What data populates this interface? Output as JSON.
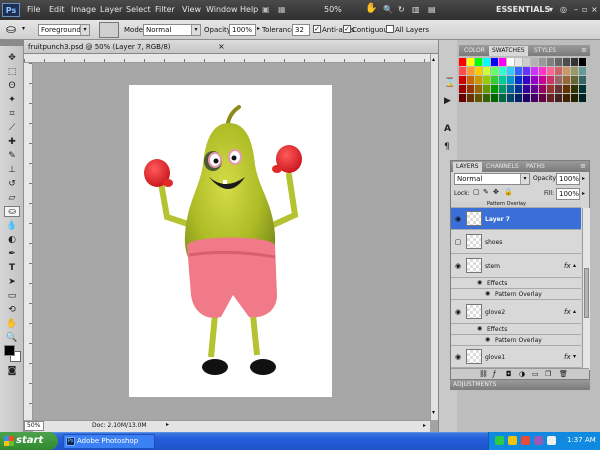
{
  "menubar": {
    "logo": "Ps",
    "items": [
      "File",
      "Edit",
      "Image",
      "Layer",
      "Select",
      "Filter",
      "View",
      "Window",
      "Help"
    ],
    "zoom": "50%",
    "workspace": "ESSENTIALS"
  },
  "options": {
    "fill_source": "Foreground",
    "mode_label": "Mode:",
    "mode_value": "Normal",
    "opacity_label": "Opacity:",
    "opacity_value": "100%",
    "tolerance_label": "Tolerance:",
    "tolerance_value": "32",
    "antialias_label": "Anti-alias",
    "contiguous_label": "Contiguous",
    "all_layers_label": "All Layers"
  },
  "document": {
    "tab_title": "fruitpunch3.psd @ 50% (Layer 7, RGB/8)",
    "zoom": "50%",
    "doc_info": "Doc: 2.10M/13.0M"
  },
  "panels": {
    "swatch_tabs": [
      "COLOR",
      "SWATCHES",
      "STYLES"
    ],
    "swatch_active": "SWATCHES",
    "swatch_colors": [
      [
        "#ff0000",
        "#ffff00",
        "#00ff00",
        "#00ffff",
        "#0000ff",
        "#ff00ff",
        "#ffffff",
        "#e6e6e6",
        "#cccccc",
        "#b3b3b3",
        "#999999",
        "#808080",
        "#666666",
        "#4d4d4d",
        "#333333",
        "#000000"
      ],
      [
        "#ff4d4d",
        "#ff9933",
        "#ffcc00",
        "#ccff33",
        "#66ff66",
        "#33ffcc",
        "#33ccff",
        "#3366ff",
        "#6633ff",
        "#cc33ff",
        "#ff33cc",
        "#ff6699",
        "#cc6666",
        "#cc9966",
        "#999966",
        "#669999"
      ],
      [
        "#cc0000",
        "#cc6600",
        "#cc9900",
        "#99cc00",
        "#33cc33",
        "#00cc99",
        "#0099cc",
        "#0033cc",
        "#3300cc",
        "#9900cc",
        "#cc0099",
        "#cc3366",
        "#996666",
        "#996633",
        "#666633",
        "#336666"
      ],
      [
        "#990000",
        "#993300",
        "#996600",
        "#669900",
        "#009900",
        "#009966",
        "#006699",
        "#003399",
        "#330099",
        "#660099",
        "#990066",
        "#993333",
        "#663333",
        "#663300",
        "#333300",
        "#003333"
      ],
      [
        "#660000",
        "#663300",
        "#665500",
        "#336600",
        "#006600",
        "#006644",
        "#004466",
        "#002266",
        "#220066",
        "#440066",
        "#660044",
        "#662222",
        "#442222",
        "#442200",
        "#222200",
        "#002222"
      ]
    ],
    "layer_tabs": [
      "LAYERS",
      "CHANNELS",
      "PATHS"
    ],
    "layer_active": "LAYERS",
    "blend_mode": "Normal",
    "opacity_label": "Opacity:",
    "opacity_value": "100%",
    "lock_label": "Lock:",
    "fill_label": "Fill:",
    "fill_value": "100%",
    "pattern_overlay_top": "Pattern Overlay",
    "layers": [
      {
        "name": "Layer 7",
        "selected": true,
        "visible": true
      },
      {
        "name": "shoes",
        "selected": false,
        "visible": false
      },
      {
        "name": "stem",
        "selected": false,
        "visible": true,
        "fx": "fx"
      },
      {
        "name": "glove2",
        "selected": false,
        "visible": true,
        "fx": "fx"
      },
      {
        "name": "glove1",
        "selected": false,
        "visible": true,
        "fx": "fx"
      }
    ],
    "effects_label": "Effects",
    "pattern_overlay_label": "Pattern Overlay",
    "adjustments_tab": "ADJUSTMENTS"
  },
  "taskbar": {
    "start_label": "start",
    "task_button": "Adobe Photoshop CS...",
    "clock": "1:37 AM"
  },
  "colors": {
    "pear": "#b6c42c",
    "shorts": "#f07a88",
    "gloves": "#e8222e",
    "selection": "#3a6fd8"
  }
}
